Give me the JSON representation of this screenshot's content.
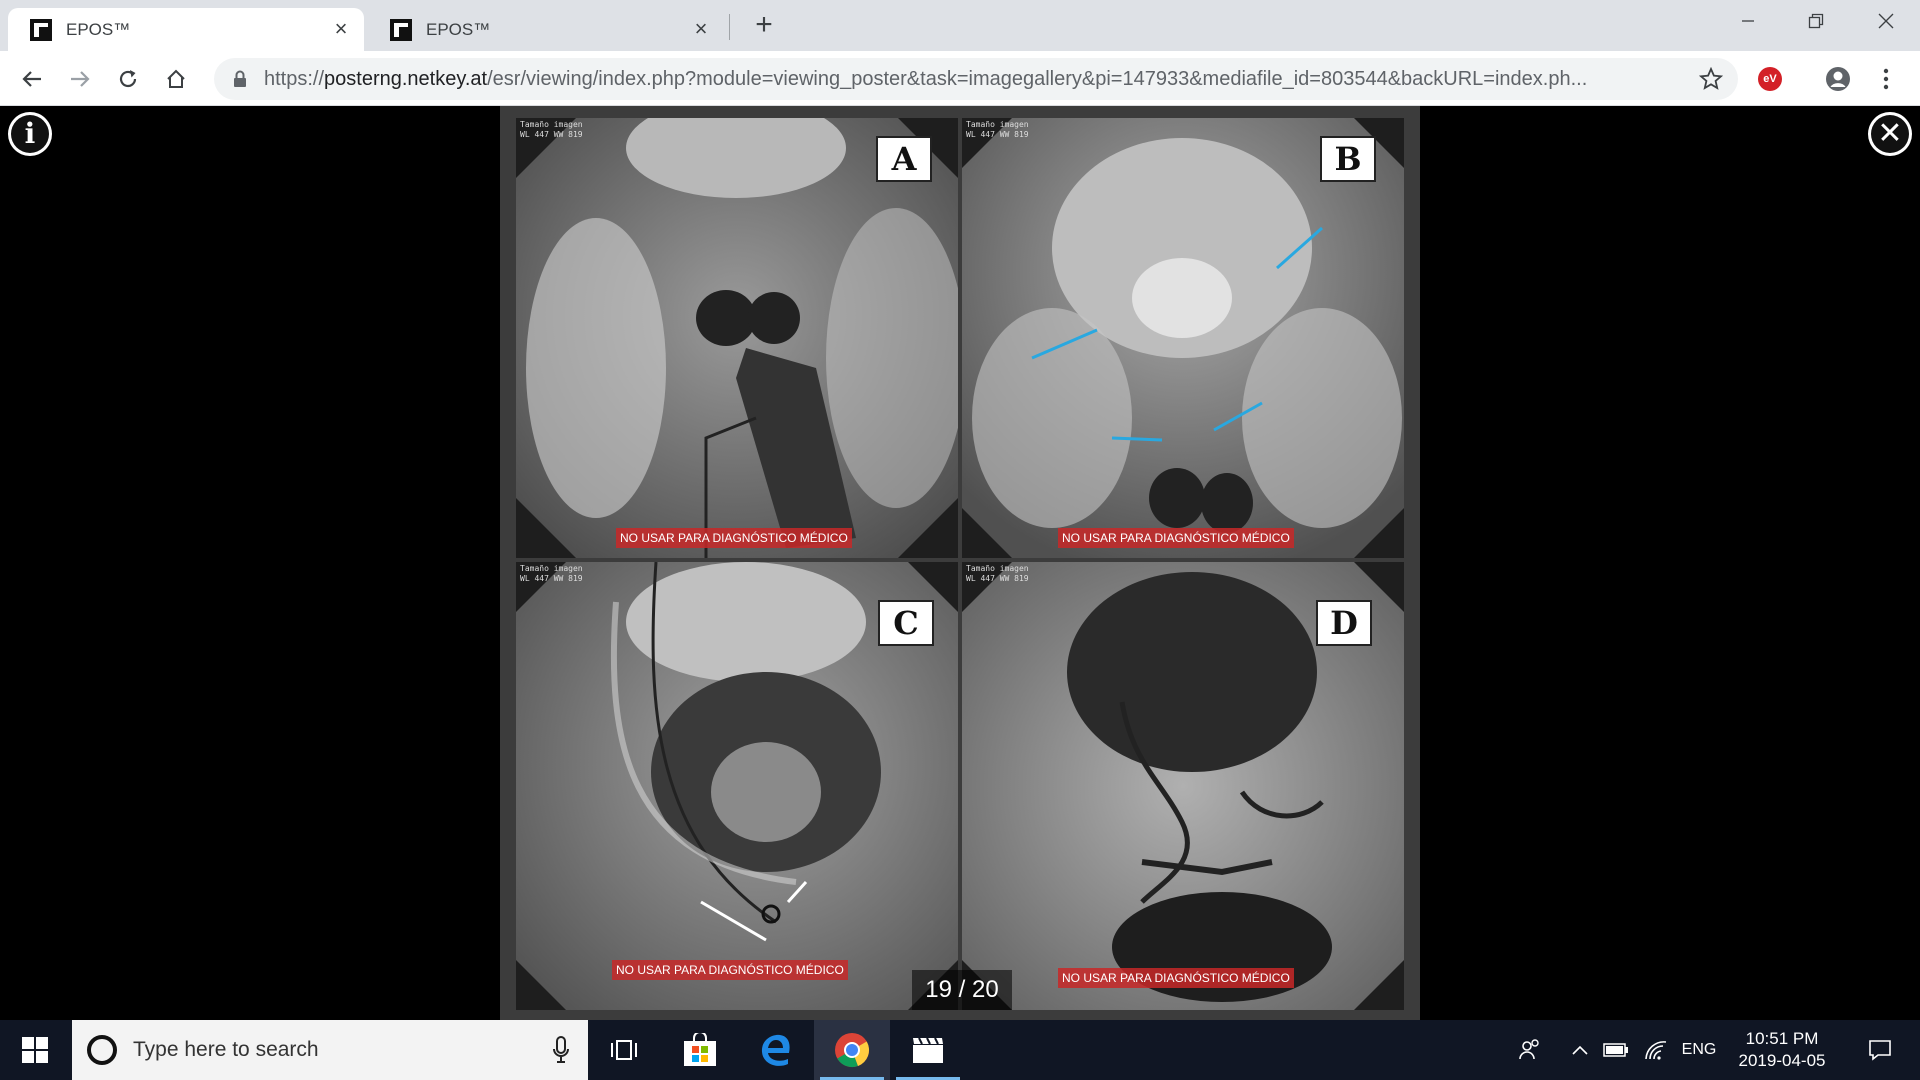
{
  "browser": {
    "tabs": [
      {
        "title": "EPOS™",
        "active": true
      },
      {
        "title": "EPOS™",
        "active": false
      }
    ],
    "url": {
      "scheme": "https://",
      "host": "posterng.netkey.at",
      "path": "/esr/viewing/index.php?module=viewing_poster&task=imagegallery&pi=147933&mediafile_id=803544&backURL=index.ph..."
    },
    "extension_badge": "eV"
  },
  "viewer": {
    "counter": "19 / 20",
    "panels": [
      {
        "letter": "A",
        "warning": "NO USAR PARA DIAGNÓSTICO MÉDICO"
      },
      {
        "letter": "B",
        "warning": "NO USAR PARA DIAGNÓSTICO MÉDICO"
      },
      {
        "letter": "C",
        "warning": "NO USAR PARA DIAGNÓSTICO MÉDICO"
      },
      {
        "letter": "D",
        "warning": "NO USAR PARA DIAGNÓSTICO MÉDICO"
      }
    ],
    "arrow_colors": {
      "blue": "#29a8e0",
      "white": "#ffffff"
    }
  },
  "taskbar": {
    "search_placeholder": "Type here to search",
    "language": "ENG",
    "time": "10:51 PM",
    "date": "2019-04-05"
  }
}
